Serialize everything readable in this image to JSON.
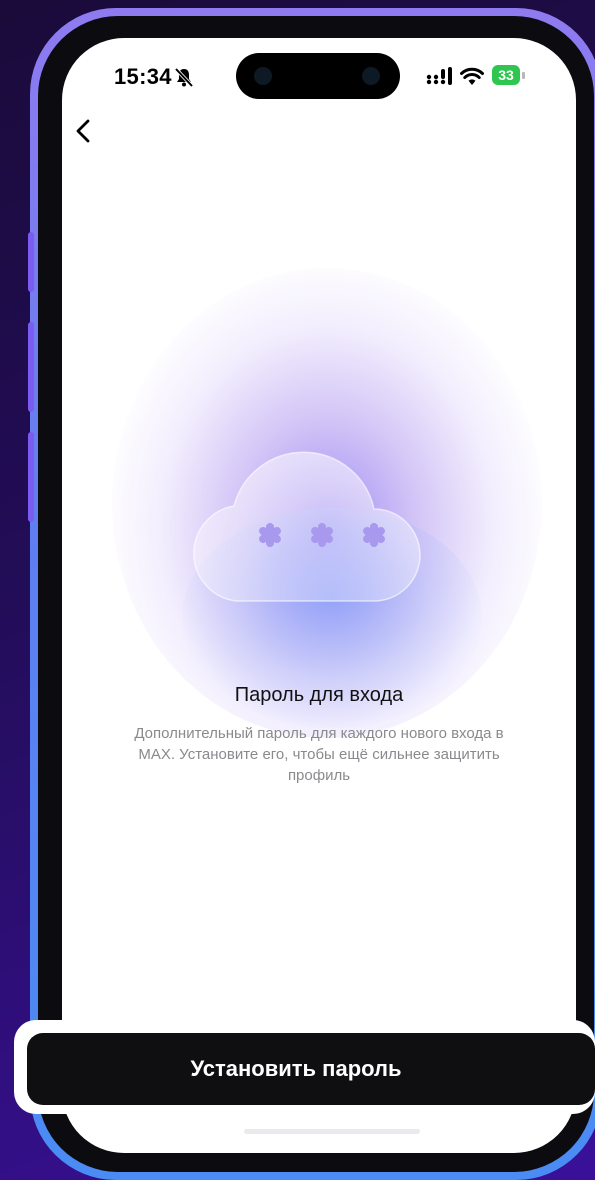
{
  "status_bar": {
    "time": "15:34",
    "battery": "33",
    "icons": [
      "bell-slash-icon",
      "signal-icon",
      "wifi-icon",
      "battery-icon"
    ]
  },
  "nav": {
    "back_icon": "chevron-left-icon"
  },
  "illustration": {
    "icon": "cloud-password-icon",
    "masked_chars": "* * *"
  },
  "content": {
    "title": "Пароль для входа",
    "description_line1": "Дополнительный пароль для каждого нового входа в",
    "description_line2": "MAX. Установите его, чтобы ещё сильнее защитить",
    "description_line3": "профиль"
  },
  "actions": {
    "primary_label": "Установить пароль"
  },
  "colors": {
    "background": "#230d5a",
    "frame_accent": "#7b5cf0",
    "glow": "#8f78f0",
    "button": "#0f0f12",
    "battery": "#2fc650"
  }
}
